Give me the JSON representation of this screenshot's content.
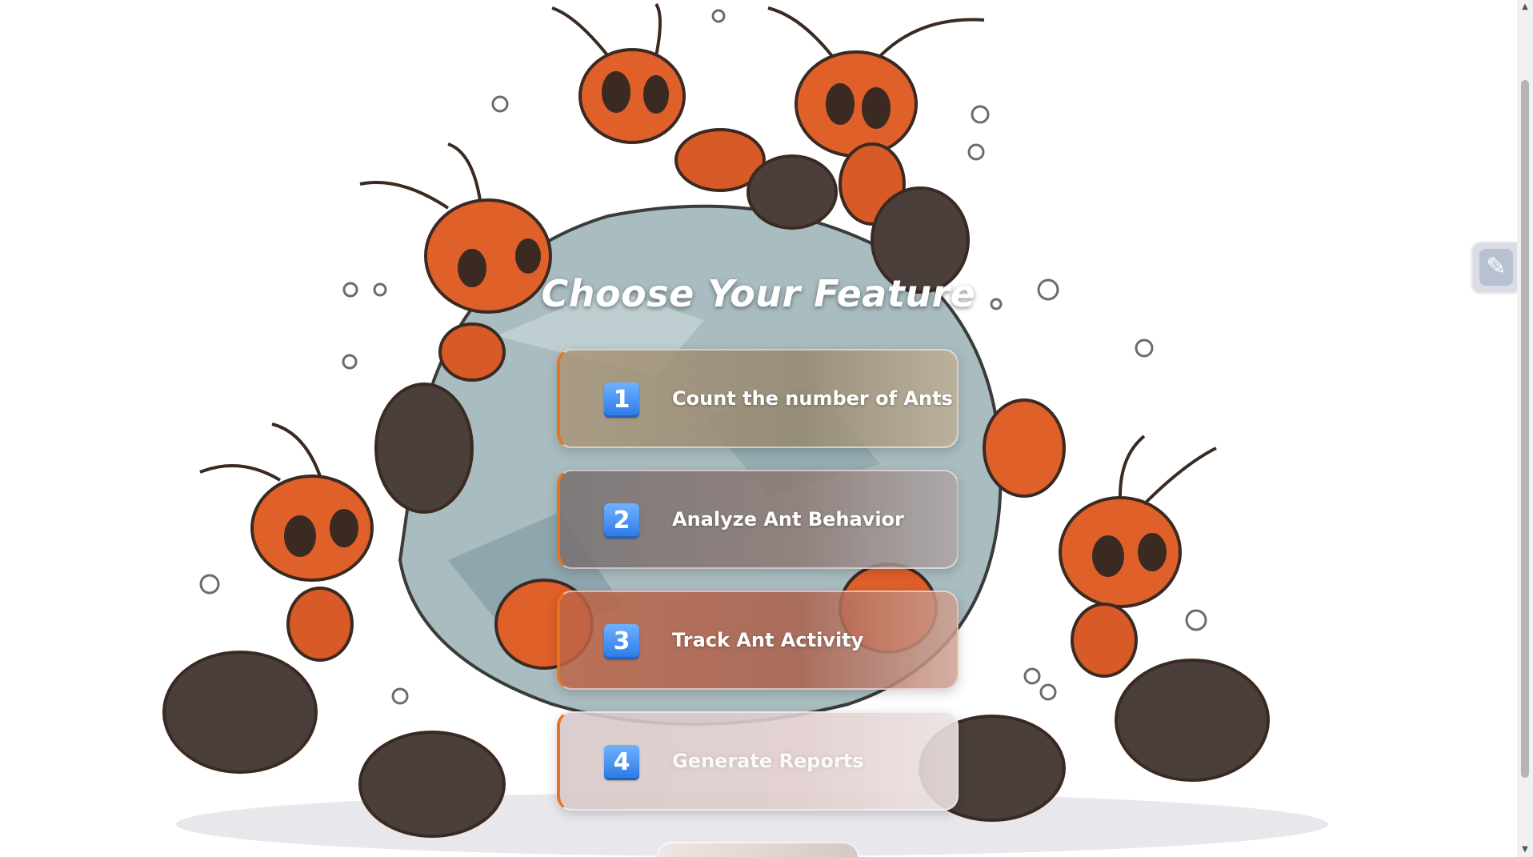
{
  "page": {
    "title": "Choose Your Feature"
  },
  "features": [
    {
      "number": "1",
      "label": "Count the number of Ants"
    },
    {
      "number": "2",
      "label": "Analyze Ant Behavior"
    },
    {
      "number": "3",
      "label": "Track Ant Activity"
    },
    {
      "number": "4",
      "label": "Generate Reports"
    }
  ],
  "side_widget": {
    "icon": "edit-pencil-icon",
    "glyph": "✎"
  },
  "scrollbar": {
    "up_glyph": "▲",
    "down_glyph": "▼"
  },
  "colors": {
    "accent": "#e8731f",
    "badge": "#3b8cf0",
    "ant_body": "#e0602a",
    "ant_abdomen": "#4a3f3a",
    "rock": "#a9bcc0"
  }
}
